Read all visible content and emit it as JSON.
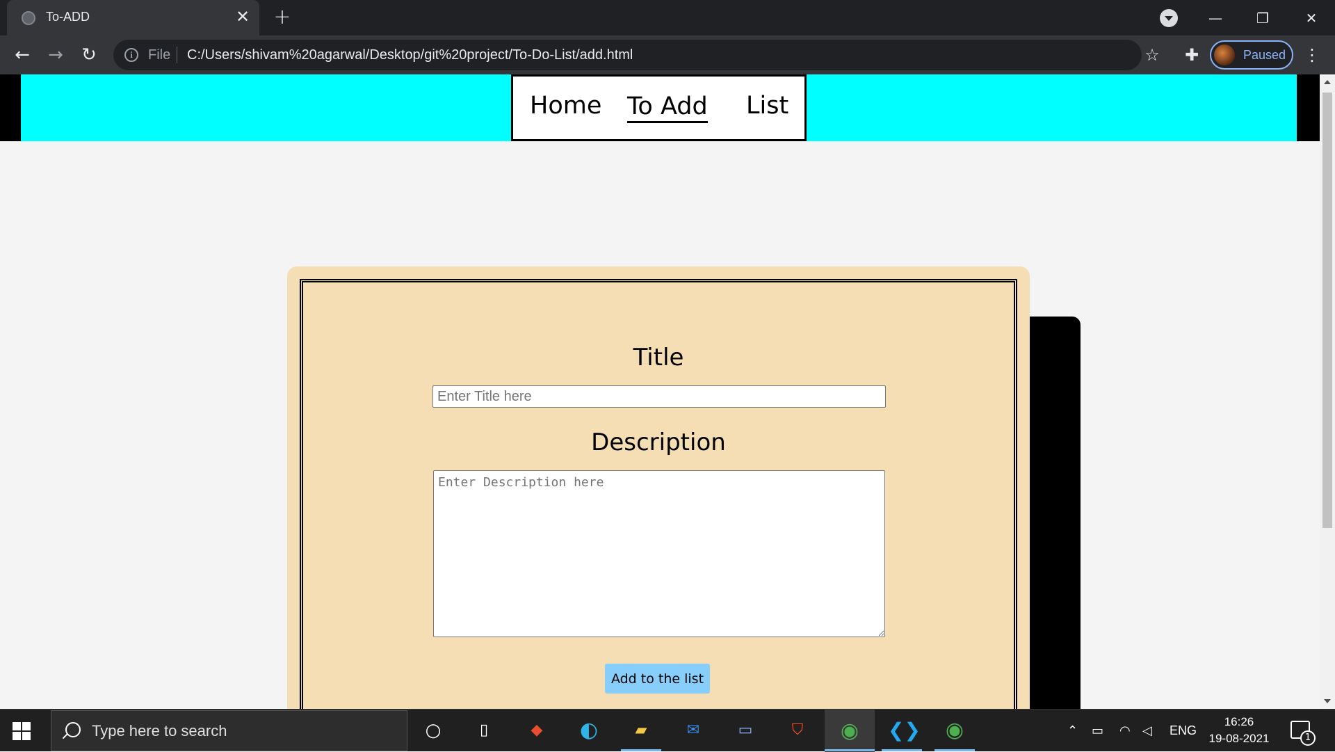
{
  "browser": {
    "tab_title": "To-ADD",
    "file_label": "File",
    "url": "C:/Users/shivam%20agarwal/Desktop/git%20project/To-Do-List/add.html",
    "profile_status": "Paused"
  },
  "site": {
    "nav": [
      {
        "label": "Home"
      },
      {
        "label": "To Add",
        "active": true
      },
      {
        "label": "List"
      }
    ],
    "form": {
      "title_label": "Title",
      "title_placeholder": "Enter Title here",
      "title_value": "",
      "description_label": "Description",
      "description_placeholder": "Enter Description here",
      "description_value": "",
      "submit_label": "Add to the list"
    },
    "colors": {
      "header": "#00ffff",
      "card": "#f5deb3",
      "button": "#87cefa"
    }
  },
  "taskbar": {
    "search_placeholder": "Type here to search",
    "language": "ENG",
    "time": "16:26",
    "date": "19-08-2021",
    "notification_count": "1",
    "apps": [
      "cortana-icon",
      "task-view-icon",
      "git-icon",
      "edge-icon",
      "file-explorer-icon",
      "mail-icon",
      "laptop-icon",
      "brave-icon",
      "chrome-icon",
      "vscode-icon",
      "chrome-icon"
    ]
  }
}
